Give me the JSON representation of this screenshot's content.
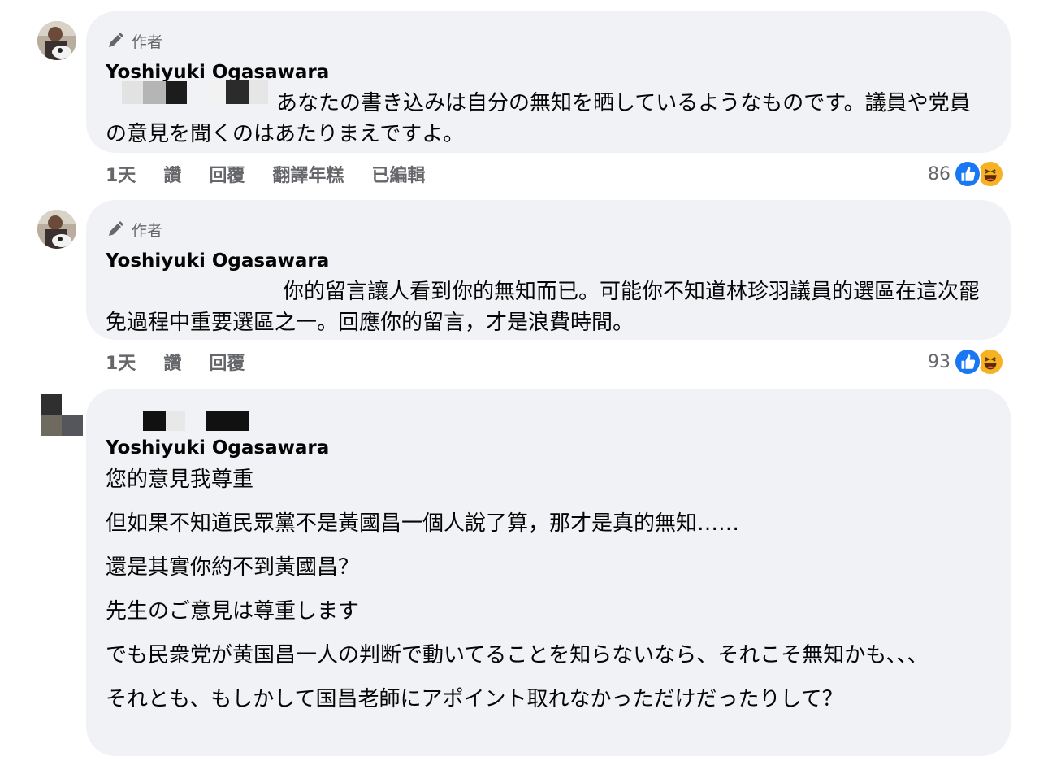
{
  "comments": [
    {
      "badge": "作者",
      "name": "Yoshiyuki Ogasawara",
      "text": "あなたの書き込みは自分の無知を晒しているようなものです。議員や党員の意見を聞くのはあたりまえですよ。",
      "actions": [
        "1天",
        "讚",
        "回覆",
        "翻譯年糕",
        "已編輯"
      ],
      "reaction_count": "86"
    },
    {
      "badge": "作者",
      "name": "Yoshiyuki Ogasawara",
      "text": "你的留言讓人看到你的無知而已。可能你不知道林珍羽議員的選區在這次罷免過程中重要選區之一。回應你的留言，才是浪費時間。",
      "actions": [
        "1天",
        "讚",
        "回覆"
      ],
      "reaction_count": "93"
    },
    {
      "name": "Yoshiyuki Ogasawara",
      "paragraphs": [
        "您的意見我尊重",
        "但如果不知道民眾黨不是黃國昌一個人說了算，那才是真的無知……",
        "還是其實你約不到黃國昌？",
        "先生のご意見は尊重します",
        "でも民衆党が黄国昌一人の判断で動いてることを知らないなら、それこそ無知かも、、、",
        "それとも、もしかして国昌老師にアポイント取れなかっただけだったりして？"
      ]
    }
  ],
  "icons": {
    "author_badge": "pencil-icon",
    "like_reaction": "like-icon",
    "haha_reaction": "haha-icon"
  },
  "colors": {
    "bubble": "#f0f2f5",
    "meta": "#65676b",
    "like": "#1877f2",
    "haha": "#f7b125"
  }
}
